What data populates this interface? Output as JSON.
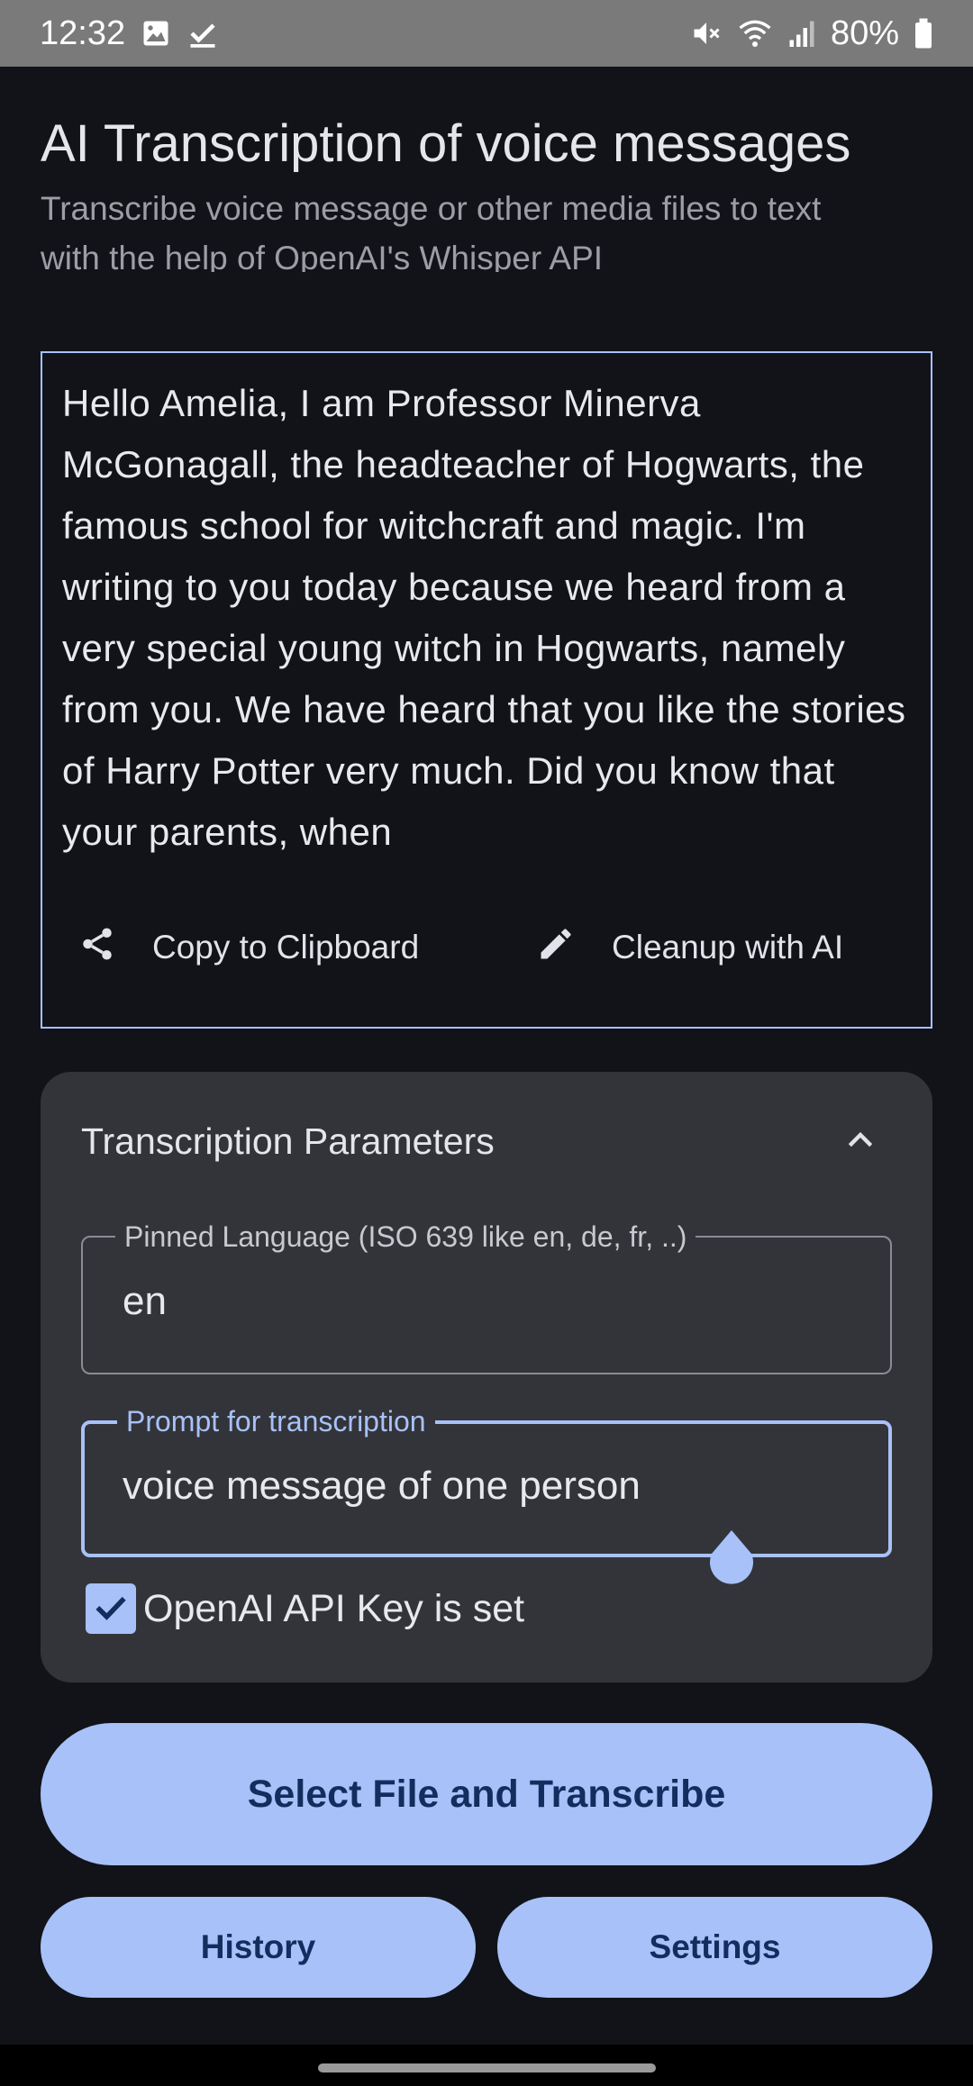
{
  "status_bar": {
    "time": "12:32",
    "battery_percent": "80%"
  },
  "header": {
    "title": "AI Transcription of voice messages",
    "subtitle": "Transcribe voice message or other media files to text with the help of OpenAI's Whisper API"
  },
  "transcript": {
    "text": "Hello Amelia, I am Professor Minerva McGonagall, the headteacher of Hogwarts, the famous school for witchcraft and magic. I'm writing to you today because we heard from a very special young witch in Hogwarts, namely from you. We have heard that you like the stories of Harry Potter very much. Did you know that your parents, when",
    "copy_label": "Copy to Clipboard",
    "cleanup_label": "Cleanup with AI"
  },
  "params": {
    "title": "Transcription Parameters",
    "language_label": "Pinned Language (ISO 639 like en, de, fr, ..)",
    "language_value": "en",
    "prompt_label": "Prompt for transcription",
    "prompt_value": "voice message of one person",
    "api_key_label": "OpenAI API Key is set",
    "api_key_checked": true
  },
  "buttons": {
    "main": "Select File and Transcribe",
    "history": "History",
    "settings": "Settings"
  },
  "colors": {
    "background": "#111318",
    "accent": "#a8c1f8",
    "card": "#333439",
    "button_text": "#132d5e"
  }
}
